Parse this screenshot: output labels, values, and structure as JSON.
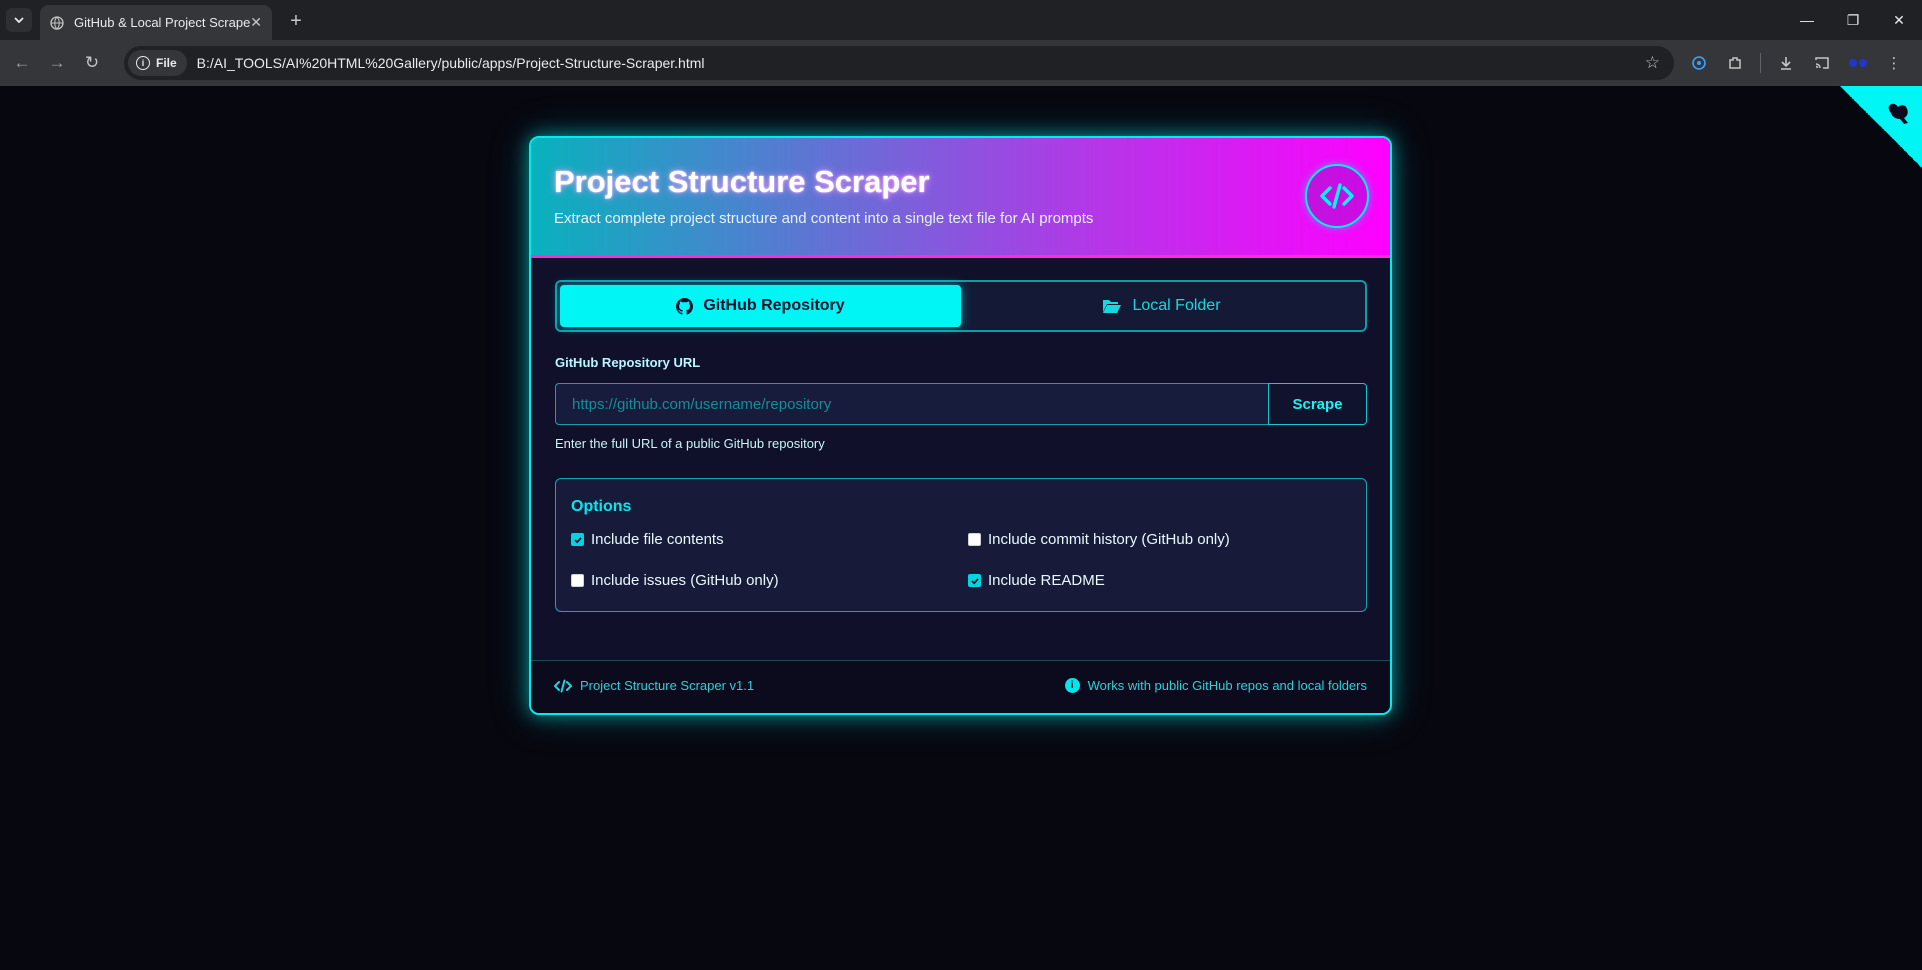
{
  "browser": {
    "tab_title": "GitHub & Local Project Scraper",
    "site_chip": "File",
    "url": "B:/AI_TOOLS/AI%20HTML%20Gallery/public/apps/Project-Structure-Scraper.html"
  },
  "header": {
    "title": "Project Structure Scraper",
    "subtitle": "Extract complete project structure and content into a single text file for AI prompts"
  },
  "tabs": [
    {
      "label": "GitHub Repository",
      "icon": "github-icon",
      "active": true
    },
    {
      "label": "Local Folder",
      "icon": "folder-open-icon",
      "active": false
    }
  ],
  "url_form": {
    "label": "GitHub Repository URL",
    "placeholder": "https://github.com/username/repository",
    "value": "",
    "button": "Scrape",
    "help": "Enter the full URL of a public GitHub repository"
  },
  "options": {
    "title": "Options",
    "items": [
      {
        "label": "Include file contents",
        "checked": true
      },
      {
        "label": "Include commit history (GitHub only)",
        "checked": false
      },
      {
        "label": "Include issues (GitHub only)",
        "checked": false
      },
      {
        "label": "Include README",
        "checked": true
      }
    ]
  },
  "footer": {
    "left": "Project Structure Scraper v1.1",
    "right": "Works with public GitHub repos and local folders"
  },
  "colors": {
    "accent": "#00f5f5",
    "magenta": "#ff00ff",
    "background": "#07070f",
    "card": "#10102a"
  }
}
